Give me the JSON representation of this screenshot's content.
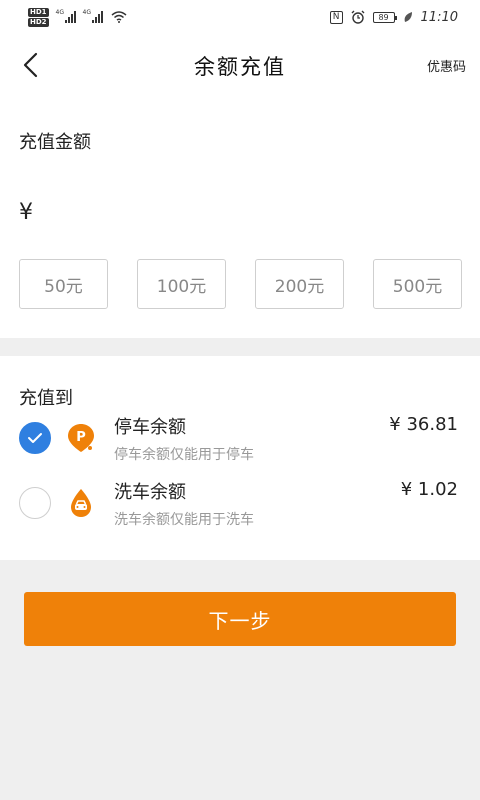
{
  "status_bar": {
    "hd1": "HD1",
    "hd2": "HD2",
    "net1": "4G",
    "net2": "4G",
    "nfc": "N",
    "battery": "89",
    "time": "11:10"
  },
  "header": {
    "title": "余额充值",
    "coupon_label": "优惠码"
  },
  "amount": {
    "label": "充值金额",
    "currency_symbol": "¥",
    "input_value": "",
    "presets": [
      "50元",
      "100元",
      "200元",
      "500元"
    ]
  },
  "target": {
    "label": "充值到",
    "options": [
      {
        "title": "停车余额",
        "description": "停车余额仅能用于停车",
        "balance": "¥ 36.81",
        "selected": true,
        "icon": "parking-icon"
      },
      {
        "title": "洗车余额",
        "description": "洗车余额仅能用于洗车",
        "balance": "¥ 1.02",
        "selected": false,
        "icon": "car-wash-icon"
      }
    ]
  },
  "next_button": {
    "label": "下一步"
  },
  "colors": {
    "accent": "#ef8109",
    "check_blue": "#2f7fe0",
    "page_bg": "#efefef"
  }
}
